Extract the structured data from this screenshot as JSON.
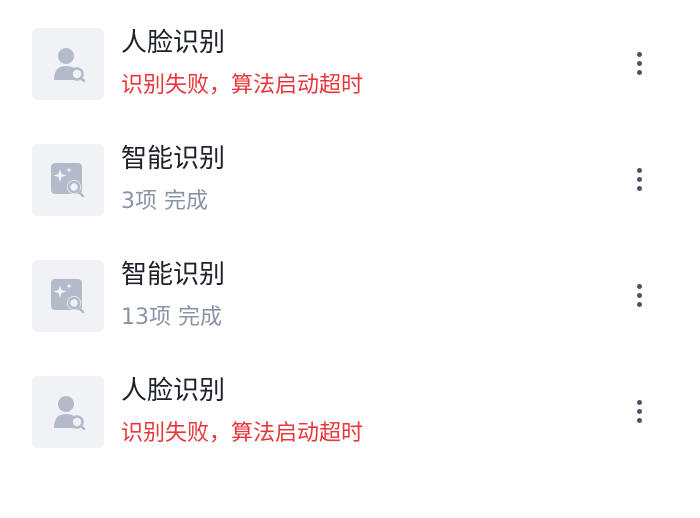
{
  "items": [
    {
      "title": "人脸识别",
      "subtitle": "识别失败，算法启动超时",
      "status": "error",
      "icon": "face-recognition-icon"
    },
    {
      "title": "智能识别",
      "subtitle": "3项 完成",
      "status": "ok",
      "icon": "smart-recognition-icon"
    },
    {
      "title": "智能识别",
      "subtitle": "13项 完成",
      "status": "ok",
      "icon": "smart-recognition-icon"
    },
    {
      "title": "人脸识别",
      "subtitle": "识别失败，算法启动超时",
      "status": "error",
      "icon": "face-recognition-icon"
    }
  ],
  "colors": {
    "title": "#1d2129",
    "error": "#e8363b",
    "ok": "#8a93a6",
    "icon": "#b3bac9",
    "thumb_bg": "#f0f2f6",
    "more": "#4b5263"
  }
}
